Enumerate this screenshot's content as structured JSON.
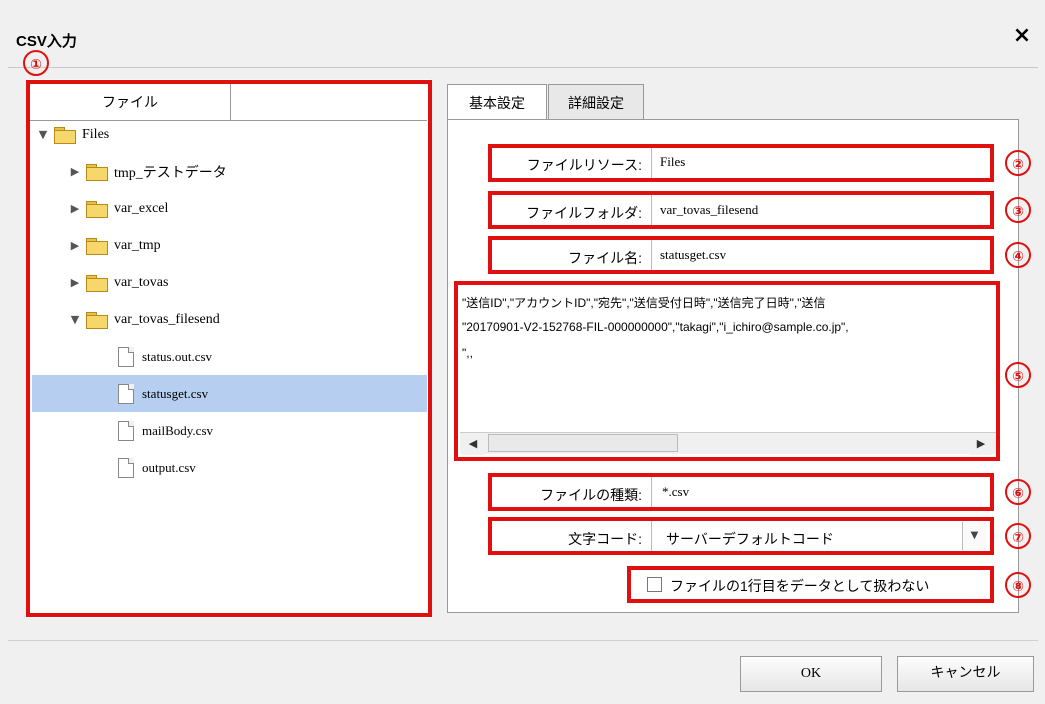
{
  "dialog": {
    "title": "CSV入力",
    "close": "×"
  },
  "markers": [
    "①",
    "②",
    "③",
    "④",
    "⑤",
    "⑥",
    "⑦",
    "⑧"
  ],
  "left": {
    "tab_label": "ファイル",
    "tree": [
      {
        "label": "Files",
        "indent": 0,
        "type": "folder",
        "expander": "▼"
      },
      {
        "label": "tmp_テストデータ",
        "indent": 1,
        "type": "folder",
        "expander": "▶"
      },
      {
        "label": "var_excel",
        "indent": 1,
        "type": "folder",
        "expander": "▶"
      },
      {
        "label": "var_tmp",
        "indent": 1,
        "type": "folder",
        "expander": "▶"
      },
      {
        "label": "var_tovas",
        "indent": 1,
        "type": "folder",
        "expander": "▶"
      },
      {
        "label": "var_tovas_filesend",
        "indent": 1,
        "type": "folder",
        "expander": "▼"
      },
      {
        "label": "status.out.csv",
        "indent": 2,
        "type": "file",
        "expander": ""
      },
      {
        "label": "statusget.csv",
        "indent": 2,
        "type": "file",
        "expander": "",
        "selected": true
      },
      {
        "label": "mailBody.csv",
        "indent": 2,
        "type": "file",
        "expander": ""
      },
      {
        "label": "output.csv",
        "indent": 2,
        "type": "file",
        "expander": ""
      }
    ]
  },
  "right": {
    "tabs": [
      "基本設定",
      "詳細設定"
    ],
    "file_resource": {
      "label": "ファイルリソース:",
      "value": "Files"
    },
    "file_folder": {
      "label": "ファイルフォルダ:",
      "value": "var_tovas_filesend"
    },
    "file_name": {
      "label": "ファイル名:",
      "value": "statusget.csv"
    },
    "preview_lines": [
      "\"送信ID\",\"アカウントID\",\"宛先\",\"送信受付日時\",\"送信完了日時\",\"送信",
      "\"20170901-V2-152768-FIL-000000000\",\"takagi\",\"i_ichiro@sample.co.jp\",",
      "\",,"
    ],
    "scroll_left": "◀",
    "scroll_right": "▶",
    "file_type": {
      "label": "ファイルの種類:",
      "value": "*.csv"
    },
    "encoding": {
      "label": "文字コード:",
      "value": "サーバーデフォルトコード",
      "arrow": "▼"
    },
    "skip_first_row": {
      "label": "ファイルの1行目をデータとして扱わない",
      "checked": false
    }
  },
  "buttons": {
    "ok": "OK",
    "cancel": "キャンセル"
  }
}
